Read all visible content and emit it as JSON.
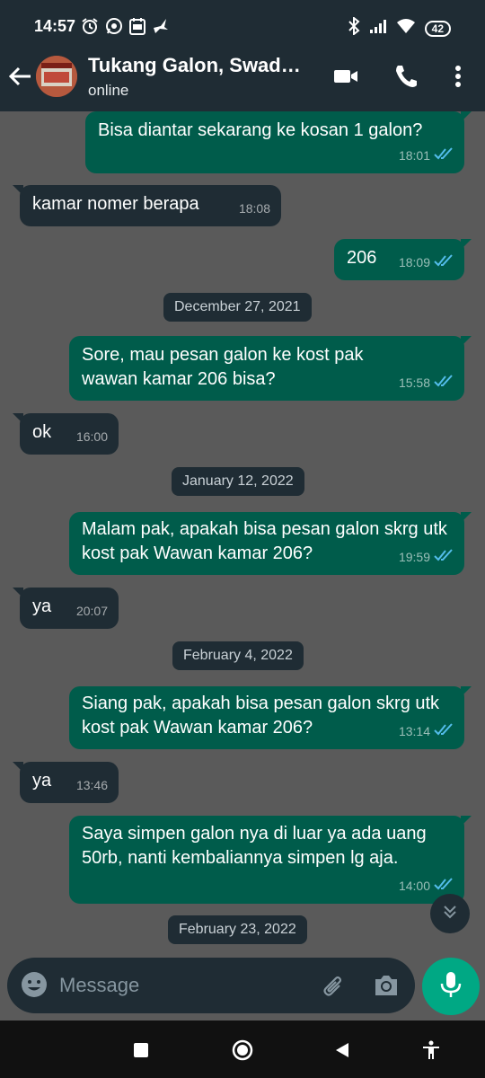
{
  "status_bar": {
    "time": "14:57",
    "battery": "42",
    "left_icons": [
      "alarm-icon",
      "whatsapp-icon",
      "calendar-icon",
      "bird-icon"
    ],
    "right_icons": [
      "bluetooth-icon",
      "signal-icon",
      "wifi-icon",
      "battery-icon"
    ]
  },
  "header": {
    "contact_name": "Tukang Galon, Swad…",
    "status": "online",
    "icons": [
      "back-arrow-icon",
      "video-call-icon",
      "phone-icon",
      "more-vert-icon"
    ]
  },
  "messages": [
    {
      "dir": "out",
      "text": "Bisa diantar sekarang ke kosan 1 galon?",
      "time": "18:01",
      "read": true
    },
    {
      "dir": "in",
      "text": "kamar nomer berapa",
      "time": "18:08"
    },
    {
      "dir": "out",
      "text": "206",
      "time": "18:09",
      "read": true
    },
    {
      "type": "date",
      "text": "December 27, 2021"
    },
    {
      "dir": "out",
      "text": "Sore, mau pesan galon ke kost pak wawan kamar 206 bisa?",
      "time": "15:58",
      "read": true
    },
    {
      "dir": "in",
      "text": "ok",
      "time": "16:00"
    },
    {
      "type": "date",
      "text": "January 12, 2022"
    },
    {
      "dir": "out",
      "text": "Malam pak, apakah bisa pesan galon skrg utk kost pak Wawan kamar 206?",
      "time": "19:59",
      "read": true
    },
    {
      "dir": "in",
      "text": "ya",
      "time": "20:07"
    },
    {
      "type": "date",
      "text": "February 4, 2022"
    },
    {
      "dir": "out",
      "text": "Siang pak, apakah bisa pesan galon skrg utk kost pak Wawan kamar 206?",
      "time": "13:14",
      "read": true
    },
    {
      "dir": "in",
      "text": "ya",
      "time": "13:46"
    },
    {
      "dir": "out",
      "text": "Saya simpen galon nya di luar ya ada uang 50rb, nanti kembaliannya simpen lg aja.",
      "time": "14:00",
      "read": true
    },
    {
      "type": "date",
      "text": "February 23, 2022"
    }
  ],
  "composer": {
    "placeholder": "Message",
    "icons": [
      "emoji-icon",
      "attach-icon",
      "camera-icon",
      "mic-icon"
    ]
  },
  "nav": {
    "icons": [
      "recents-icon",
      "home-icon",
      "back-icon",
      "accessibility-icon"
    ]
  },
  "colors": {
    "bar_bg": "#1f2c34",
    "outgoing_bubble": "#005c4b",
    "incoming_bubble": "#1f2c34",
    "chat_bg": "#5a5a5a",
    "accent": "#00a884",
    "read_ticks": "#53bdeb"
  }
}
